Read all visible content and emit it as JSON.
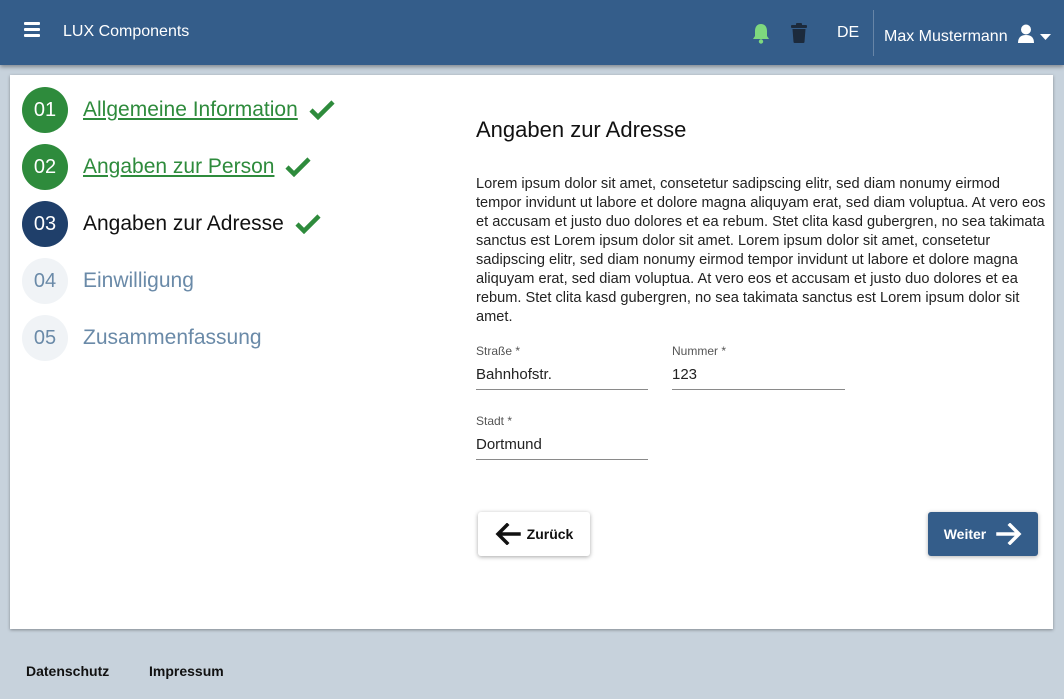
{
  "header": {
    "app_title": "LUX Components",
    "language": "DE",
    "user_name": "Max Mustermann",
    "icons": [
      "menu-icon",
      "bell-icon",
      "trash-icon",
      "user-icon",
      "caret-down-icon"
    ],
    "bell_color": "#7ed87e"
  },
  "stepper": {
    "steps": [
      {
        "number": "01",
        "label": "Allgemeine Information",
        "state": "done"
      },
      {
        "number": "02",
        "label": "Angaben zur Person",
        "state": "done"
      },
      {
        "number": "03",
        "label": "Angaben zur Adresse",
        "state": "active"
      },
      {
        "number": "04",
        "label": "Einwilligung",
        "state": "todo"
      },
      {
        "number": "05",
        "label": "Zusammenfassung",
        "state": "todo"
      }
    ]
  },
  "form": {
    "title": "Angaben zur Adresse",
    "text": "Lorem ipsum dolor sit amet, consetetur sadipscing elitr, sed diam nonumy eirmod tempor invidunt ut labore et dolore magna aliquyam erat, sed diam voluptua. At vero eos et accusam et justo duo dolores et ea rebum. Stet clita kasd gubergren, no sea takimata sanctus est Lorem ipsum dolor sit amet. Lorem ipsum dolor sit amet, consetetur sadipscing elitr, sed diam nonumy eirmod tempor invidunt ut labore et dolore magna aliquyam erat, sed diam voluptua. At vero eos et accusam et justo duo dolores et ea rebum. Stet clita kasd gubergren, no sea takimata sanctus est Lorem ipsum dolor sit amet.",
    "street": {
      "label": "Straße *",
      "value": "Bahnhofstr."
    },
    "number": {
      "label": "Nummer *",
      "value": "123"
    },
    "city": {
      "label": "Stadt *",
      "value": "Dortmund"
    },
    "back_label": "Zurück",
    "next_label": "Weiter"
  },
  "footer": {
    "privacy": "Datenschutz",
    "imprint": "Impressum"
  },
  "colors": {
    "header": "#345d8a",
    "done": "#2e8b3c",
    "active": "#1f3f6a",
    "todo_text": "#6a8aa8"
  }
}
